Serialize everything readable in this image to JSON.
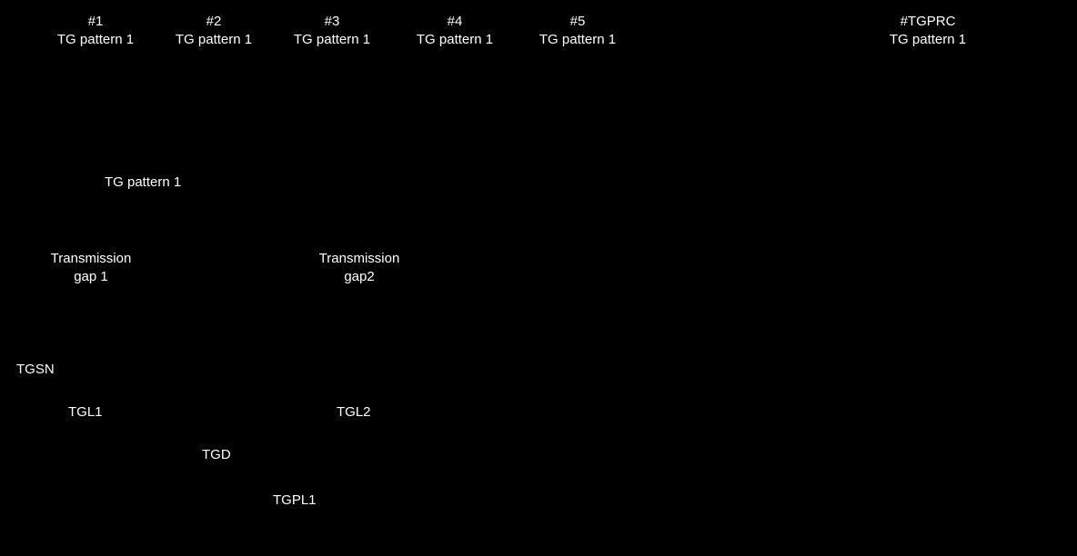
{
  "frames": [
    {
      "num": "#1",
      "sub": "TG pattern 1"
    },
    {
      "num": "#2",
      "sub": "TG pattern 1"
    },
    {
      "num": "#3",
      "sub": "TG pattern 1"
    },
    {
      "num": "#4",
      "sub": "TG pattern 1"
    },
    {
      "num": "#5",
      "sub": "TG pattern 1"
    },
    {
      "num": "#TGPRC",
      "sub": "TG pattern 1"
    }
  ],
  "mid": {
    "pattern": "TG pattern 1",
    "gap1_a": "Transmission",
    "gap1_b": "gap 1",
    "gap2_a": "Transmission",
    "gap2_b": "gap2"
  },
  "params": {
    "tgsn": "TGSN",
    "tgl1": "TGL1",
    "tgl2": "TGL2",
    "tgd": "TGD",
    "tgpl1": "TGPL1"
  }
}
